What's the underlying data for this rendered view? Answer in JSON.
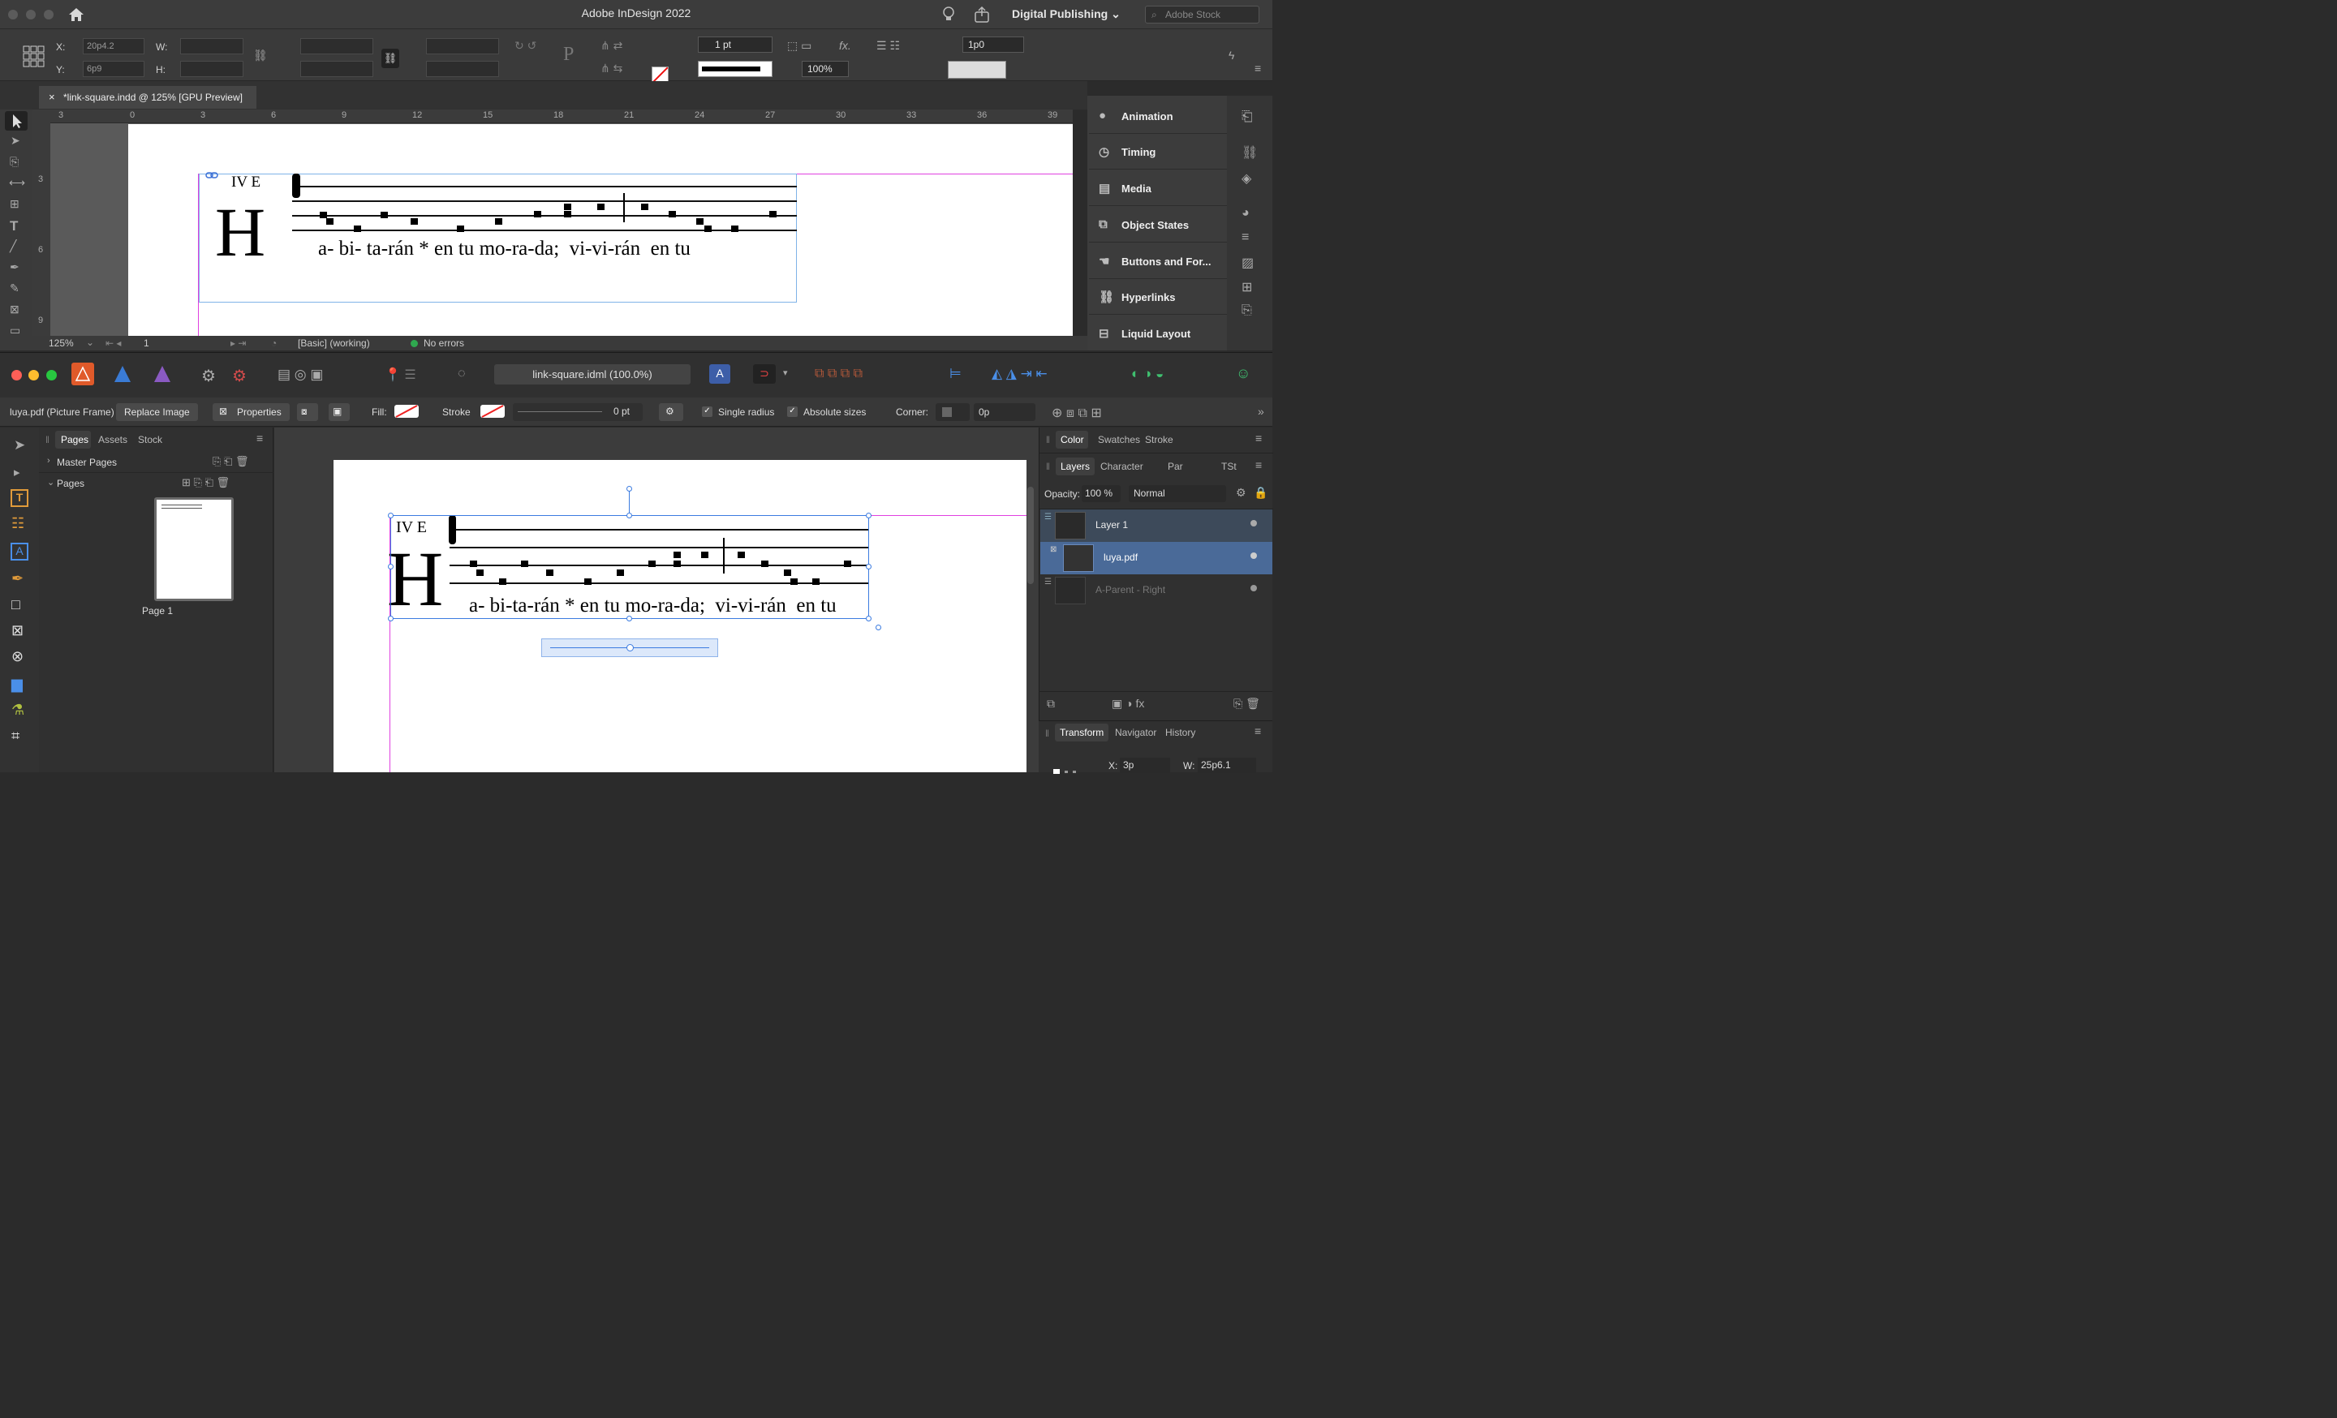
{
  "indesign": {
    "app_title": "Adobe InDesign 2022",
    "workspace": "Digital Publishing",
    "stock_placeholder": "Adobe Stock",
    "control": {
      "x_label": "X:",
      "x_value": "20p4.2",
      "y_label": "Y:",
      "y_value": "6p9",
      "w_label": "W:",
      "h_label": "H:",
      "stroke_weight": "1 pt",
      "opacity": "100%",
      "offset": "1p0"
    },
    "doc_tab": "*link-square.indd @ 125% [GPU Preview]",
    "ruler_h": [
      "3",
      "0",
      "3",
      "6",
      "9",
      "12",
      "15",
      "18",
      "21",
      "24",
      "27",
      "30",
      "33",
      "36",
      "39"
    ],
    "ruler_v": [
      "3",
      "6",
      "9"
    ],
    "status": {
      "zoom": "125%",
      "page": "1",
      "profile": "[Basic] (working)",
      "errors": "No errors"
    },
    "panels": [
      "Animation",
      "Timing",
      "Media",
      "Object States",
      "Buttons and For...",
      "Hyperlinks",
      "Liquid Layout"
    ]
  },
  "affinity": {
    "doc_name": "link-square.idml (100.0%)",
    "context": {
      "selection": "luya.pdf (Picture Frame)",
      "replace_image": "Replace Image",
      "properties": "Properties",
      "fill_label": "Fill:",
      "stroke_label": "Stroke",
      "stroke_value": "0 pt",
      "single_radius": "Single radius",
      "absolute_sizes": "Absolute sizes",
      "corner_label": "Corner:",
      "corner_value": "0p"
    },
    "left_tabs": [
      "Pages",
      "Assets",
      "Stock"
    ],
    "master_pages": "Master Pages",
    "pages_section": "Pages",
    "page_label": "Page 1",
    "right_tabs_1": [
      "Color",
      "Swatches",
      "Stroke"
    ],
    "right_tabs_2": [
      "Layers",
      "Character",
      "Par",
      "TSt"
    ],
    "opacity_label": "Opacity:",
    "opacity_value": "100 %",
    "blend_mode": "Normal",
    "layers": [
      "Layer 1",
      "luya.pdf",
      "A-Parent - Right"
    ],
    "bottom_tabs": [
      "Transform",
      "Navigator",
      "History"
    ],
    "transform": {
      "x_label": "X:",
      "x_value": "3p",
      "w_label": "W:",
      "w_value": "25p6.1"
    }
  },
  "score": {
    "mode": "IV E",
    "initial": "H",
    "lyrics": [
      "a-",
      "bi-",
      "ta-",
      "rán",
      "*",
      "en",
      "tu",
      "mo-",
      "ra-",
      "da;",
      "vi-",
      "vi-",
      "rán",
      "en",
      "tu"
    ]
  }
}
